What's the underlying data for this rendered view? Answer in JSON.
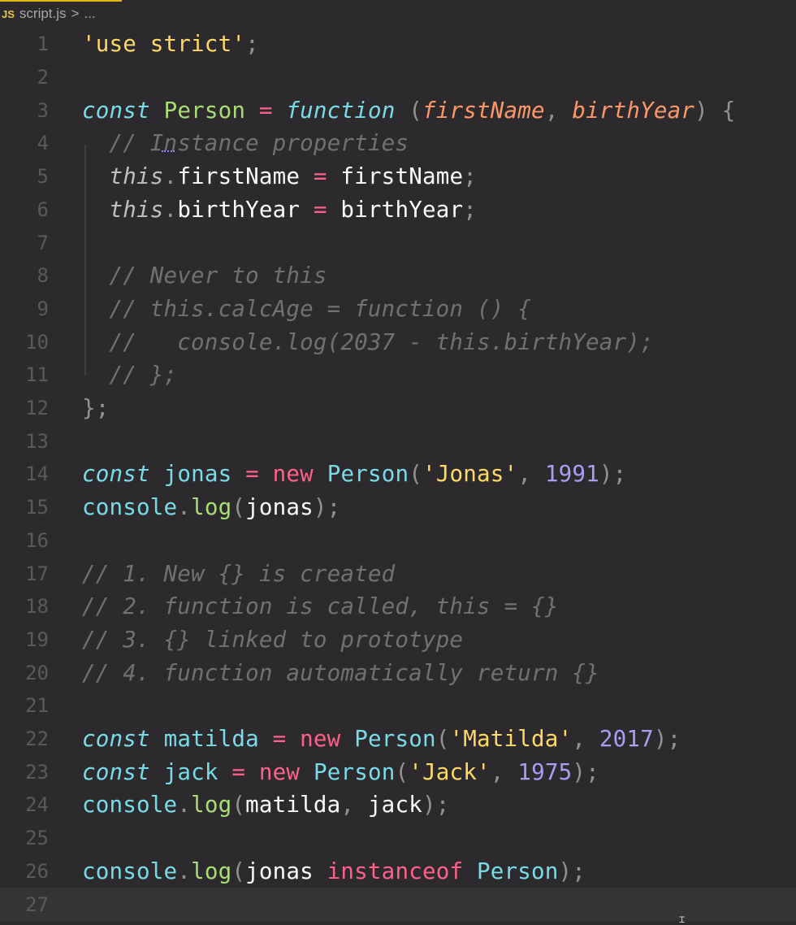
{
  "breadcrumb": {
    "file_icon": "JS",
    "file_name": "script.js",
    "separator": ">",
    "path_rest": "..."
  },
  "editor": {
    "line_numbers": [
      "1",
      "2",
      "3",
      "4",
      "5",
      "6",
      "7",
      "8",
      "9",
      "10",
      "11",
      "12",
      "13",
      "14",
      "15",
      "16",
      "17",
      "18",
      "19",
      "20",
      "21",
      "22",
      "23",
      "24",
      "25",
      "26",
      "27"
    ]
  }
}
